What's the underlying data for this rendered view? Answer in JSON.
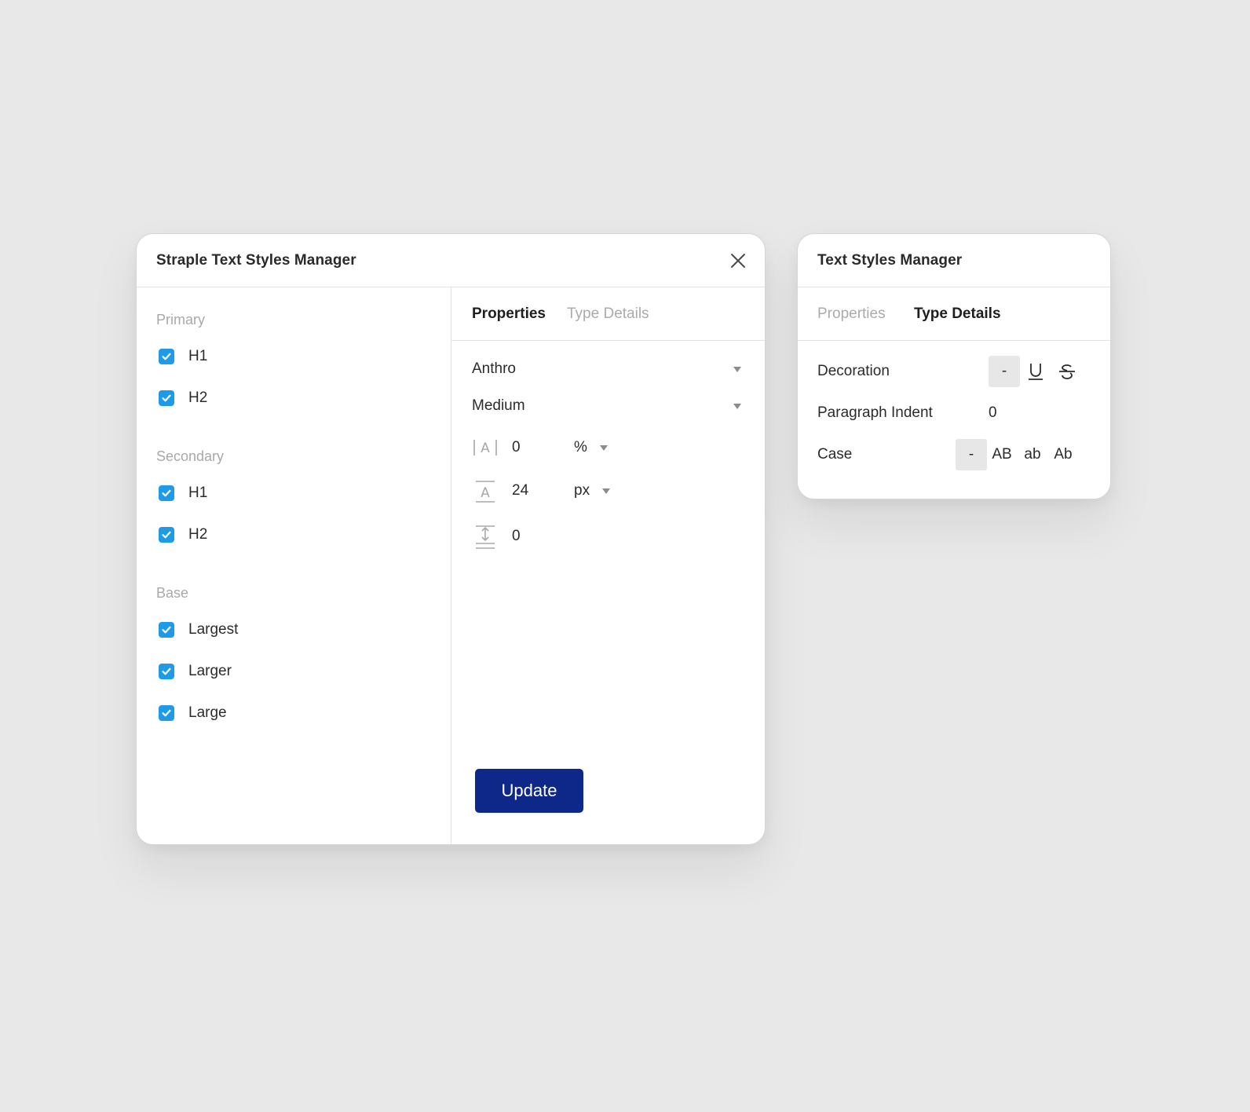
{
  "main_panel": {
    "title": "Straple Text Styles Manager",
    "groups": [
      {
        "label": "Primary",
        "items": [
          {
            "label": "H1",
            "checked": true
          },
          {
            "label": "H2",
            "checked": true
          }
        ]
      },
      {
        "label": "Secondary",
        "items": [
          {
            "label": "H1",
            "checked": true
          },
          {
            "label": "H2",
            "checked": true
          }
        ]
      },
      {
        "label": "Base",
        "items": [
          {
            "label": "Largest",
            "checked": true
          },
          {
            "label": "Larger",
            "checked": true
          },
          {
            "label": "Large",
            "checked": true
          }
        ]
      }
    ],
    "tabs": [
      {
        "label": "Properties",
        "active": true
      },
      {
        "label": "Type Details",
        "active": false
      }
    ],
    "font_family": "Anthro",
    "font_weight": "Medium",
    "letter_spacing": {
      "value": "0",
      "unit": "%"
    },
    "font_size": {
      "value": "24",
      "unit": "px"
    },
    "paragraph_spacing": {
      "value": "0"
    },
    "update_label": "Update"
  },
  "side_panel": {
    "title": "Text Styles Manager",
    "tabs": [
      {
        "label": "Properties",
        "active": false
      },
      {
        "label": "Type Details",
        "active": true
      }
    ],
    "decoration": {
      "label": "Decoration",
      "options": [
        "-",
        "U",
        "S"
      ],
      "selected": "-"
    },
    "paragraph_indent": {
      "label": "Paragraph Indent",
      "value": "0"
    },
    "case": {
      "label": "Case",
      "options": [
        "-",
        "AB",
        "ab",
        "Ab"
      ],
      "selected": "-"
    }
  },
  "colors": {
    "background": "#e8e8e8",
    "checkbox": "#1e9be8",
    "primary_button": "#0e2889"
  }
}
